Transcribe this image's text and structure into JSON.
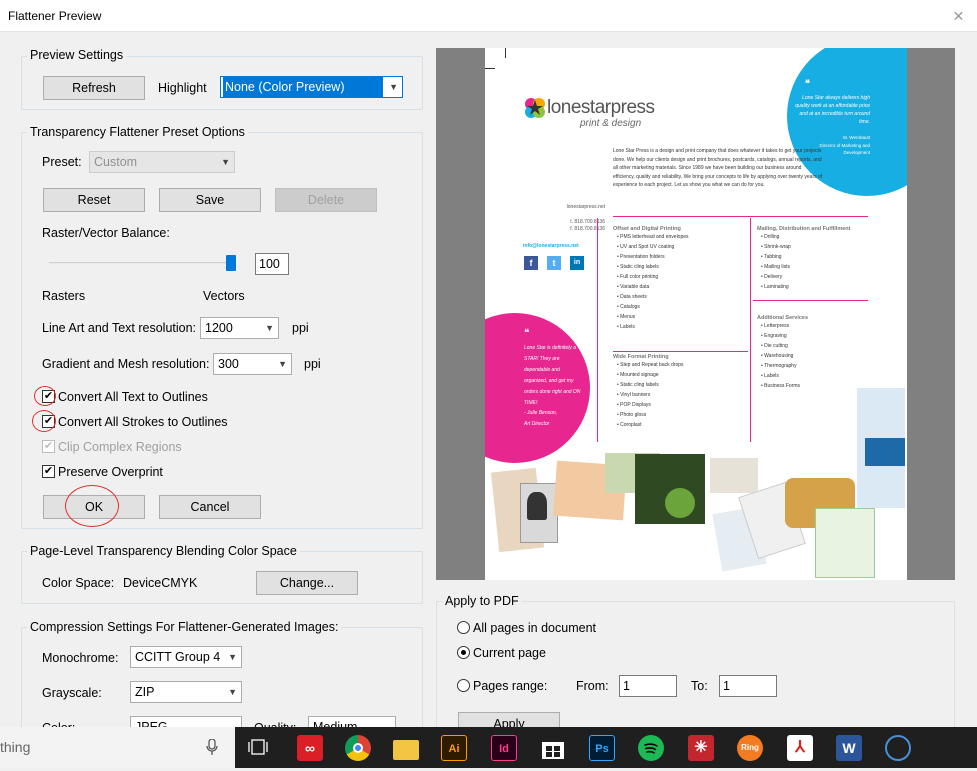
{
  "window": {
    "title": "Flattener Preview",
    "close_glyph": "✕"
  },
  "preview_settings": {
    "title": "Preview Settings",
    "refresh_label": "Refresh",
    "highlight_label": "Highlight",
    "highlight_value": "None (Color Preview)"
  },
  "preset_options": {
    "title": "Transparency Flattener Preset Options",
    "preset_label": "Preset:",
    "preset_value": "Custom",
    "reset_label": "Reset",
    "save_label": "Save",
    "delete_label": "Delete",
    "balance_label": "Raster/Vector Balance:",
    "balance_value": "100",
    "rasters_label": "Rasters",
    "vectors_label": "Vectors",
    "line_art_label": "Line Art and Text resolution:",
    "line_art_value": "1200",
    "line_art_unit": "ppi",
    "gradient_label": "Gradient and Mesh resolution:",
    "gradient_value": "300",
    "gradient_unit": "ppi",
    "convert_text_label": "Convert All Text to Outlines",
    "convert_strokes_label": "Convert All Strokes to Outlines",
    "clip_complex_label": "Clip Complex Regions",
    "preserve_overprint_label": "Preserve Overprint",
    "ok_label": "OK",
    "cancel_label": "Cancel"
  },
  "blending": {
    "title": "Page-Level Transparency Blending Color Space",
    "color_space_label": "Color Space:",
    "color_space_value": "DeviceCMYK",
    "change_label": "Change..."
  },
  "compression": {
    "title": "Compression Settings For Flattener-Generated Images:",
    "monochrome_label": "Monochrome:",
    "monochrome_value": "CCITT Group 4",
    "grayscale_label": "Grayscale:",
    "grayscale_value": "ZIP",
    "color_label": "Color:",
    "color_value": "JPEG",
    "quality_label": "Quality:",
    "quality_value": "Medium"
  },
  "apply": {
    "title": "Apply to PDF",
    "all_pages_label": "All pages in document",
    "current_page_label": "Current page",
    "pages_range_label": "Pages range:",
    "from_label": "From:",
    "from_value": "1",
    "to_label": "To:",
    "to_value": "1",
    "apply_label": "Apply"
  },
  "document": {
    "brand": "lonestarpress",
    "tagline": "print & design",
    "quote_top": "Lone Star always delivers high quality work at an affordable price and at an incredible turn around time.",
    "quote_top_author": "M. Wernbautt",
    "quote_top_role": "Director of Marketing and Development",
    "intro": "Lone Star Press is a design and print company that does whatever it takes to get your projects done. We help our clients design and print brochures, postcards, catalogs, annual reports, and all other marketing materials. Since 1989 we have been building our business around efficiency, quality and reliability. We bring your concepts to life by applying over twenty years of experience to each project. Let us show you what we can do for you.",
    "website": "lonestarpress.net",
    "phone_t": "t. 818.700.8136",
    "phone_f": "f. 818.700.8136",
    "email": "info@lonestarpress.net",
    "sections": [
      {
        "title": "Offset and Digital Printing",
        "items": [
          "PMS letterhead and envelopes",
          "UV and Spot UV coating",
          "Presentation folders",
          "Static cling labels",
          "Full color printing",
          "Variable data",
          "Data sheets",
          "Catalogs",
          "Menus",
          "Labels"
        ]
      },
      {
        "title": "Mailing, Distribution and Fulfillment",
        "items": [
          "Drilling",
          "Shrink-wrap",
          "Tabbing",
          "Mailing lists",
          "Delivery",
          "Laminating"
        ]
      },
      {
        "title": "Additional Services",
        "items": [
          "Letterpress",
          "Engraving",
          "Die cutting",
          "Warehousing",
          "Thermography",
          "Labels",
          "Business Forms"
        ]
      },
      {
        "title": "Wide Format Printing",
        "items": [
          "Step and Repeat back drops",
          "Mounted signage",
          "Static cling labels",
          "Vinyl banners",
          "POP Displays",
          "Photo gloss",
          "Coroplast"
        ]
      }
    ],
    "quote_bottom": "Lone Star is definitely a STAR! They are dependable and organized, and get my orders done right and ON TIME!",
    "quote_bottom_author": "- Julie Benson,",
    "quote_bottom_role": "Art Director",
    "social": [
      "f",
      "t",
      "in"
    ]
  },
  "taskbar": {
    "search_text": "thing",
    "apps": [
      "creative-cloud",
      "chrome",
      "file-explorer",
      "illustrator",
      "indesign",
      "windows-store",
      "photoshop",
      "spotify",
      "network-app",
      "ring-central",
      "acrobat",
      "word",
      "remote-app"
    ],
    "labels": {
      "ai": "Ai",
      "id": "Id",
      "ps": "Ps",
      "ring": "Ring"
    }
  },
  "colors": {
    "accent_blue": "#0078d7",
    "circle_red": "#e0302a",
    "cyan": "#17aee4",
    "magenta": "#e8268f"
  }
}
